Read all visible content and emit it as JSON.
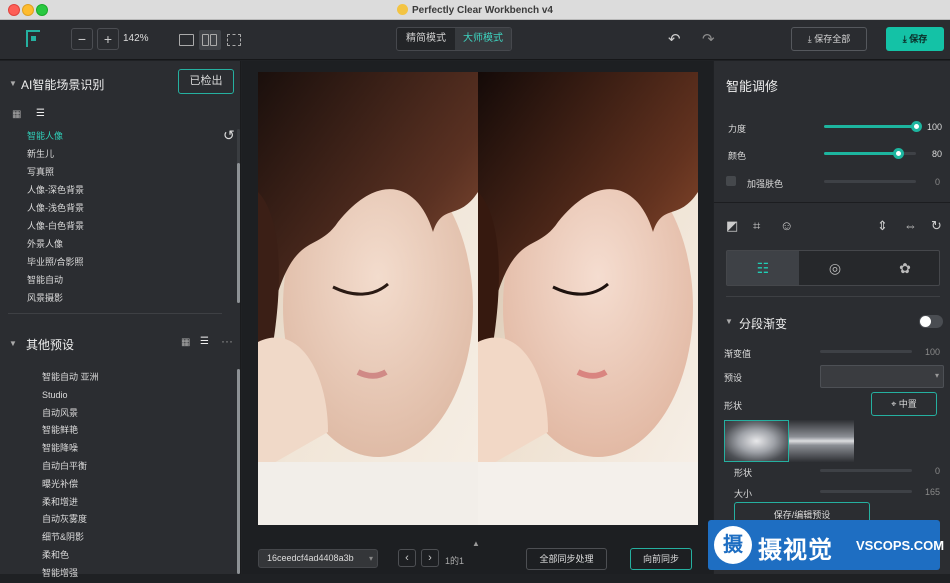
{
  "window": {
    "title": "Perfectly Clear Workbench v4"
  },
  "toolbar": {
    "zoom_minus": "−",
    "zoom_plus": "+",
    "zoom_value": "142%",
    "mode_simple": "精简模式",
    "mode_master": "大师模式",
    "undo_icon": "↶",
    "redo_icon": "↷",
    "save_all": "保存全部",
    "save": "保存"
  },
  "left": {
    "section1": {
      "title": "AI智能场景识别",
      "detect_button": "已检出",
      "items": [
        {
          "label": "智能人像",
          "active": true
        },
        {
          "label": "新生儿"
        },
        {
          "label": "写真照"
        },
        {
          "label": "人像-深色背景"
        },
        {
          "label": "人像-浅色背景"
        },
        {
          "label": "人像-白色背景"
        },
        {
          "label": "外景人像"
        },
        {
          "label": "毕业照/合影照"
        },
        {
          "label": "智能自动"
        },
        {
          "label": "风景摄影"
        }
      ]
    },
    "section2": {
      "title": "其他预设",
      "more": "···",
      "items": [
        {
          "label": "智能自动 亚洲"
        },
        {
          "label": "Studio"
        },
        {
          "label": "自动风景"
        },
        {
          "label": "智能鲜艳"
        },
        {
          "label": "智能降噪"
        },
        {
          "label": "自动白平衡"
        },
        {
          "label": "曝光补偿"
        },
        {
          "label": "柔和增进"
        },
        {
          "label": "自动灰雾度"
        },
        {
          "label": "细节&阴影"
        },
        {
          "label": "柔和色"
        },
        {
          "label": "智能增强"
        }
      ]
    }
  },
  "center": {
    "image_name": "16ceedcf4ad4408a3b",
    "page": "1的1",
    "sync_all": "全部同步处理",
    "sync_forward": "向前同步",
    "prev_icon": "‹",
    "next_icon": "›"
  },
  "right": {
    "title": "智能调修",
    "strength": {
      "label": "力度",
      "value": "100",
      "level": 1.0
    },
    "color": {
      "label": "颜色",
      "value": "80",
      "level": 0.8
    },
    "skin": {
      "label": "加强肤色",
      "value": "0"
    },
    "segment": {
      "title": "分段渐变",
      "gradient_label": "渐变值",
      "gradient_value": "100",
      "preset_label": "预设",
      "shape_label": "形状",
      "center_button": "中置",
      "shape_value_label": "形状",
      "shape_value": "0",
      "size_label": "大小",
      "size_value": "165",
      "save_preset": "保存/编辑预设"
    }
  },
  "watermark": {
    "brand": "摄视觉",
    "url": "VSCOPS.COM",
    "logo_char": "摄"
  },
  "colors": {
    "accent": "#1db59f",
    "background": "#2b2d31"
  }
}
